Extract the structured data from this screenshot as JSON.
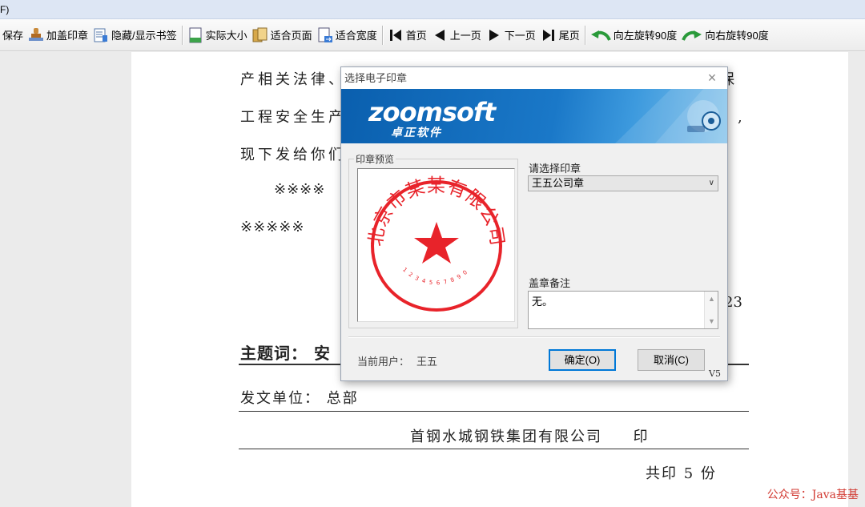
{
  "menu": {
    "label": "F)"
  },
  "toolbar": {
    "save": "保存",
    "stamp": "加盖印章",
    "toggle_bookmark": "隐藏/显示书签",
    "actual_size": "实际大小",
    "fit_page": "适合页面",
    "fit_width": "适合宽度",
    "first": "首页",
    "prev": "上一页",
    "next": "下一页",
    "last": "尾页",
    "rotate_left": "向左旋转90度",
    "rotate_right": "向右旋转90度"
  },
  "document": {
    "line1_left": "产相关法律、",
    "line1_right": "保",
    "line2_left": "工程安全生产",
    "line2_right": "》,",
    "line3_left": "现下发给你们",
    "line4": "※※※※",
    "line5": "※※※※※",
    "date_fragment": "23",
    "subject_label": "主题词：",
    "subject_value": "安",
    "issuer": "发文单位：  总部",
    "seal_line": "首钢水城钢铁集团有限公司     印",
    "copies": "共印 5 份",
    "watermark": "公众号：Java基基"
  },
  "dialog": {
    "title": "选择电子印章",
    "brand": "zoomsoft",
    "brand_cn": "卓正软件",
    "preview_label": "印章预览",
    "select_label": "请选择印章",
    "selected_seal": "王五公司章",
    "remark_label": "盖章备注",
    "remark_value": "无。",
    "current_user_label": "当前用户：",
    "current_user": "王五",
    "ok": "确定(O)",
    "cancel": "取消(C)",
    "version": "V5",
    "seal": {
      "org_name": "北京市某某有限公司",
      "code": "1234567890",
      "color": "#e8232a"
    }
  },
  "colors": {
    "accent": "#0078d7",
    "banner": "#0a5fae",
    "seal": "#e8232a",
    "watermark": "#d23a32"
  },
  "icons": [
    "save-icon",
    "stamp-icon",
    "bookmark-icon",
    "actual-size-icon",
    "fit-page-icon",
    "fit-width-icon",
    "first-page-icon",
    "prev-page-icon",
    "next-page-icon",
    "last-page-icon",
    "rotate-left-icon",
    "rotate-right-icon",
    "close-icon",
    "chevron-down-icon",
    "star-icon"
  ]
}
